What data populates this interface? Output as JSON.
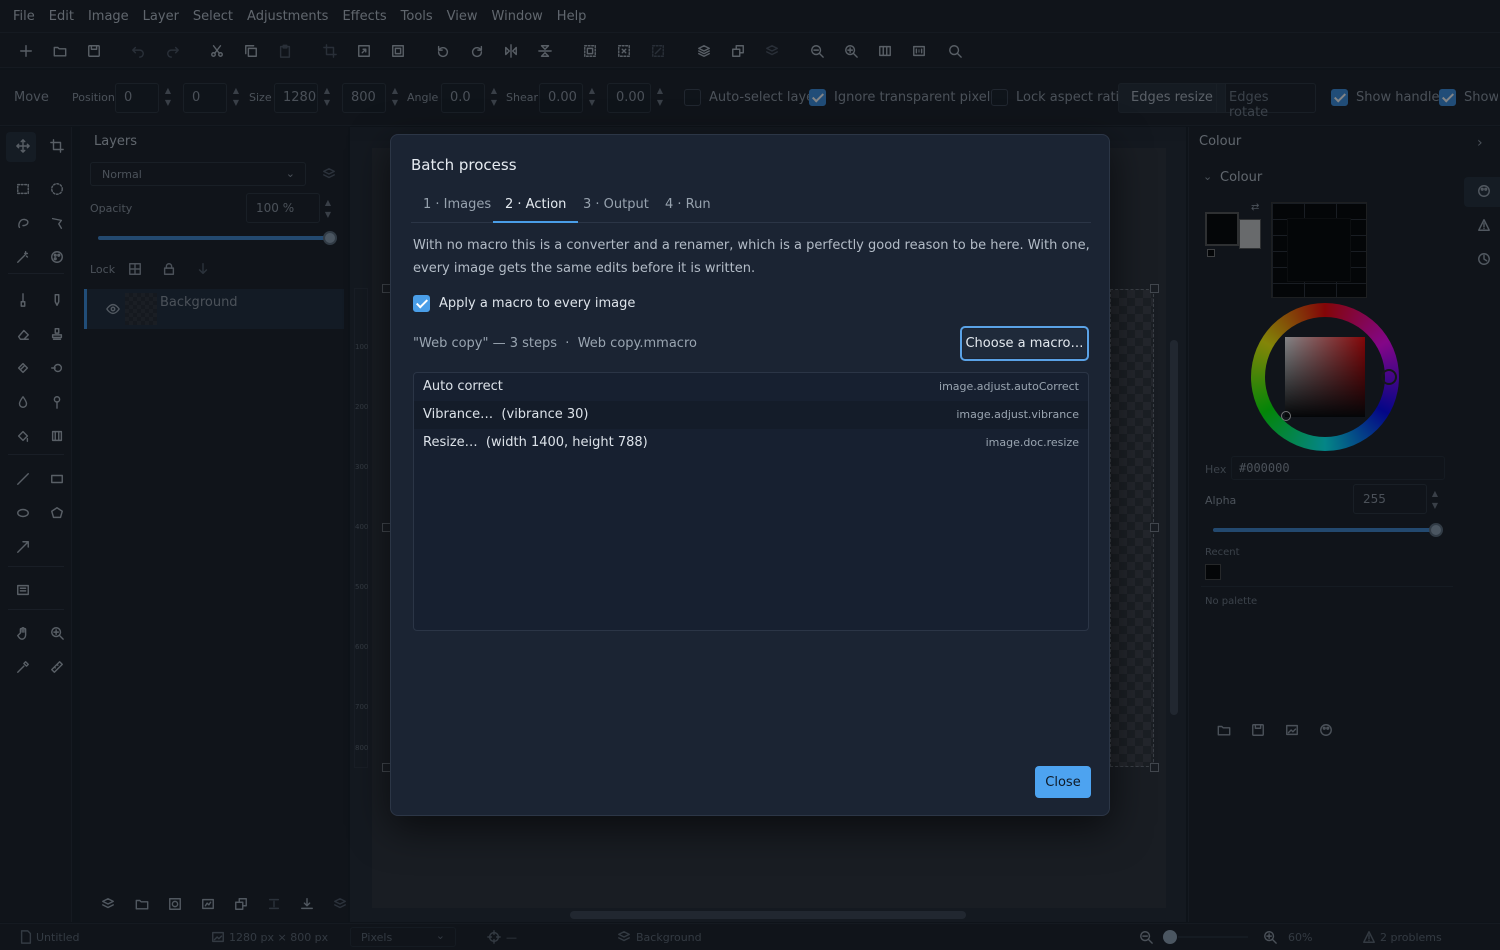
{
  "menu": [
    "File",
    "Edit",
    "Image",
    "Layer",
    "Select",
    "Adjustments",
    "Effects",
    "Tools",
    "View",
    "Window",
    "Help"
  ],
  "options_bar": {
    "tool_name": "Move",
    "position_label": "Position",
    "position_x": "0",
    "position_y": "0",
    "size_label": "Size",
    "size_w": "1280",
    "size_h": "800",
    "angle_label": "Angle",
    "angle": "0.0",
    "shear_label": "Shear",
    "shear_x": "0.00",
    "shear_y": "0.00",
    "auto_select": {
      "label": "Auto-select layer",
      "checked": false
    },
    "ignore_transparent": {
      "label": "Ignore transparent pixels",
      "checked": true
    },
    "lock_aspect": {
      "label": "Lock aspect ratio",
      "checked": false
    },
    "edges_resize": "Edges resize",
    "edges_rotate": "Edges rotate",
    "show_handles": {
      "label": "Show handles",
      "checked": true
    },
    "show_more": {
      "label": "Show",
      "checked": true
    }
  },
  "layers_panel": {
    "title": "Layers",
    "blend_mode": "Normal",
    "opacity_label": "Opacity",
    "opacity_value": "100 %",
    "opacity": 1.0,
    "lock_label": "Lock",
    "layer_name": "Background"
  },
  "ruler_labels": [
    "100",
    "200",
    "300",
    "400",
    "500",
    "600",
    "700",
    "800"
  ],
  "colour_panel": {
    "title": "Colour",
    "section": "Colour",
    "hex_label": "Hex",
    "hex_value": "#000000",
    "alpha_label": "Alpha",
    "alpha_value": "255",
    "alpha": 1.0,
    "recent_label": "Recent",
    "palette_label": "No palette"
  },
  "status_bar": {
    "doc_name": "Untitled",
    "dimensions": "1280 px × 800 px",
    "units": "Pixels",
    "cursor": "—",
    "layer": "Background",
    "zoom": "60%",
    "problems": "2 problems"
  },
  "dialog": {
    "title": "Batch process",
    "tabs": [
      "1 · Images",
      "2 · Action",
      "3 · Output",
      "4 · Run"
    ],
    "active_tab": "2 · Action",
    "description": "With no macro this is a converter and a renamer, which is a perfectly good reason to be here. With one, every image gets the same edits before it is written.",
    "apply_macro": {
      "label": "Apply a macro to every image",
      "checked": true
    },
    "macro_info": "\"Web copy\" — 3 steps  ·  Web copy.mmacro",
    "choose_button": "Choose a macro…",
    "steps": [
      {
        "name": "Auto correct",
        "command": "image.adjust.autoCorrect"
      },
      {
        "name": "Vibrance…  (vibrance 30)",
        "command": "image.adjust.vibrance"
      },
      {
        "name": "Resize…  (width 1400, height 788)",
        "command": "image.doc.resize"
      }
    ],
    "close_button": "Close"
  },
  "colors": {
    "accent": "#4a9ee8",
    "dialog_bg": "#1b2433",
    "app_bg": "#181d25"
  }
}
